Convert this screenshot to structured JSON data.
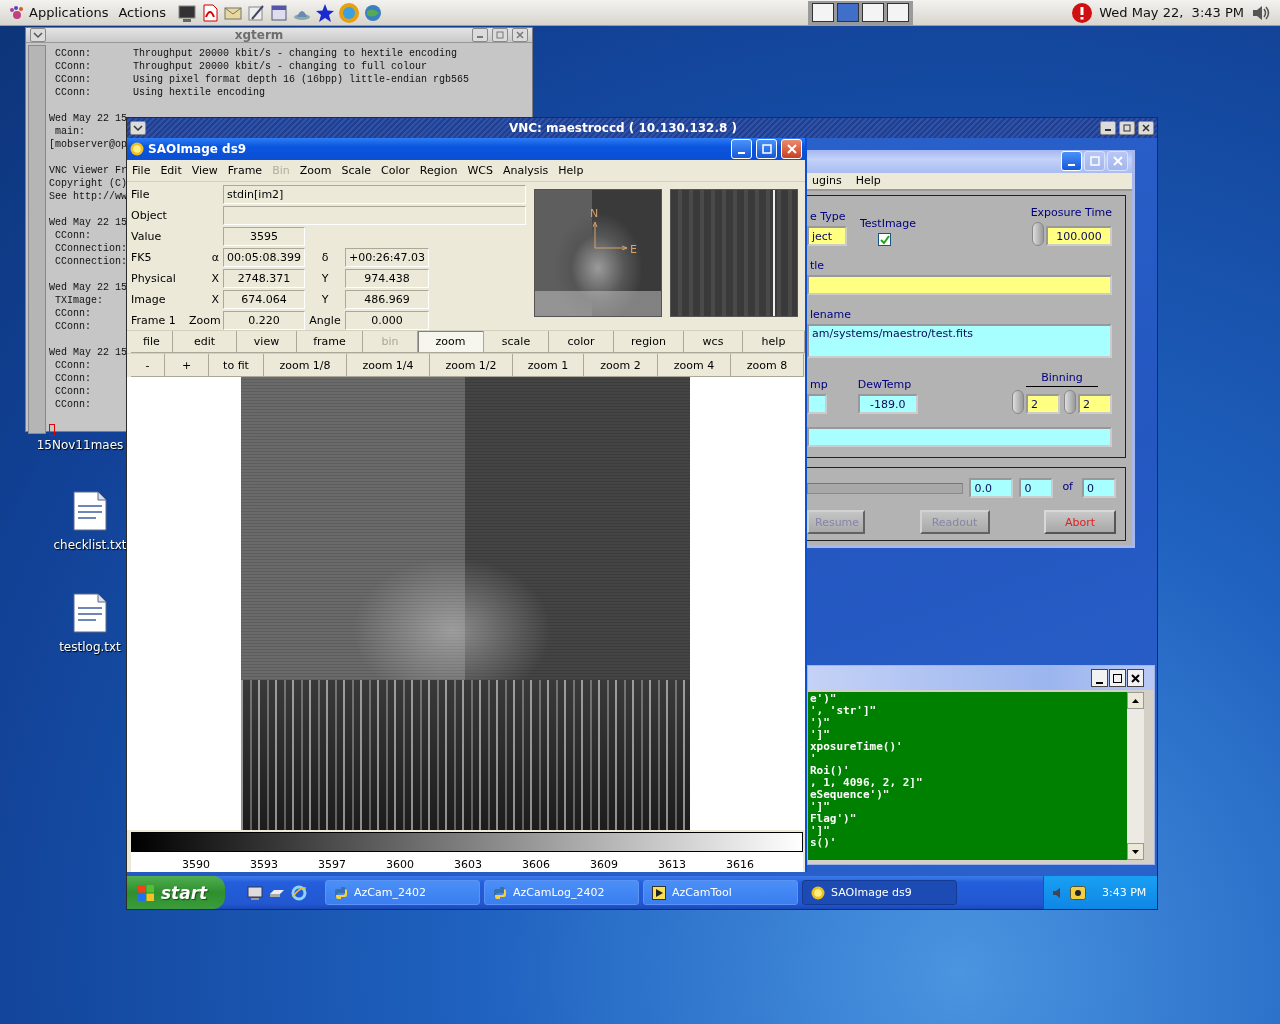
{
  "top_panel": {
    "menus": [
      "Applications",
      "Actions"
    ],
    "workspaces": [
      {
        "selected": false
      },
      {
        "selected": true
      },
      {
        "selected": false
      },
      {
        "selected": false
      }
    ],
    "clock": "Wed May 22,  3:43 PM"
  },
  "desktop_icons": [
    {
      "label": "15Nov11maes",
      "kind": "hidden"
    },
    {
      "label": "checklist.txt",
      "kind": "text"
    },
    {
      "label": "testlog.txt",
      "kind": "text"
    }
  ],
  "xgterm": {
    "title": "xgterm",
    "blocks": [
      [
        " CConn:       Throughput 20000 kbit/s - changing to hextile encoding",
        " CConn:       Throughput 20000 kbit/s - changing to full colour",
        " CConn:       Using pixel format depth 16 (16bpp) little-endian rgb565",
        " CConn:       Using hextile encoding"
      ],
      [
        "Wed May 22 15",
        " main:",
        "[mobserver@op"
      ],
      [
        "VNC Viewer Fr",
        "Copyright (C)",
        "See http://ww"
      ],
      [
        "Wed May 22 15",
        " CConn:",
        " CConnection:",
        " CConnection:"
      ],
      [
        "Wed May 22 15",
        " TXImage:",
        " CConn:",
        " CConn:"
      ],
      [
        "Wed May 22 15",
        " CConn:",
        " CConn:",
        " CConn:",
        " CConn:"
      ]
    ]
  },
  "vnc": {
    "title": "VNC: maestroccd ( 10.130.132.8 )",
    "ds9": {
      "title": "SAOImage ds9",
      "menu": [
        {
          "label": "File",
          "disabled": false
        },
        {
          "label": "Edit",
          "disabled": false
        },
        {
          "label": "View",
          "disabled": false
        },
        {
          "label": "Frame",
          "disabled": false
        },
        {
          "label": "Bin",
          "disabled": true
        },
        {
          "label": "Zoom",
          "disabled": false
        },
        {
          "label": "Scale",
          "disabled": false
        },
        {
          "label": "Color",
          "disabled": false
        },
        {
          "label": "Region",
          "disabled": false
        },
        {
          "label": "WCS",
          "disabled": false
        },
        {
          "label": "Analysis",
          "disabled": false
        },
        {
          "label": "Help",
          "disabled": false
        }
      ],
      "info": {
        "file": {
          "label": "File",
          "value": "stdin[im2]"
        },
        "object": {
          "label": "Object"
        },
        "value": {
          "label": "Value",
          "value": "3595"
        },
        "rows": [
          {
            "label": "FK5",
            "sub1": "α",
            "value1": "00:05:08.399",
            "sub2": "δ",
            "value2": "+00:26:47.03"
          },
          {
            "label": "Physical",
            "sub1": "X",
            "value1": "2748.371",
            "sub2": "Y",
            "value2": "974.438"
          },
          {
            "label": "Image",
            "sub1": "X",
            "value1": "674.064",
            "sub2": "Y",
            "value2": "486.969"
          },
          {
            "label": "Frame 1",
            "sub1": "Zoom",
            "value1": "0.220",
            "sub2": "Angle",
            "value2": "0.000"
          }
        ]
      },
      "panner": {
        "compass": [
          "N",
          "E"
        ]
      },
      "buttons": [
        {
          "label": "file",
          "selected": false,
          "disabled": false
        },
        {
          "label": "edit",
          "selected": false,
          "disabled": false
        },
        {
          "label": "view",
          "selected": false,
          "disabled": false
        },
        {
          "label": "frame",
          "selected": false,
          "disabled": false
        },
        {
          "label": "bin",
          "selected": false,
          "disabled": true
        },
        {
          "label": "zoom",
          "selected": true,
          "disabled": false
        },
        {
          "label": "scale",
          "selected": false,
          "disabled": false
        },
        {
          "label": "color",
          "selected": false,
          "disabled": false
        },
        {
          "label": "region",
          "selected": false,
          "disabled": false
        },
        {
          "label": "wcs",
          "selected": false,
          "disabled": false
        },
        {
          "label": "help",
          "selected": false,
          "disabled": false
        }
      ],
      "zoom_buttons": [
        "-",
        "+",
        "to fit",
        "zoom 1/8",
        "zoom 1/4",
        "zoom 1/2",
        "zoom 1",
        "zoom 2",
        "zoom 4",
        "zoom 8"
      ],
      "colorbar_ticks": [
        "3590",
        "3593",
        "3597",
        "3600",
        "3603",
        "3606",
        "3609",
        "3613",
        "3616"
      ]
    },
    "azcamtool": {
      "menu": [
        "ugins",
        "Help"
      ],
      "image_type": {
        "label": "e Type",
        "value": "ject"
      },
      "test_image": {
        "label": "TestImage",
        "checked": true
      },
      "exposure": {
        "label": "Exposure Time",
        "value": "100.000"
      },
      "title_field": {
        "label": "tle"
      },
      "filename": {
        "label": "lename",
        "value": "am/systems/maestro/test.fits"
      },
      "temp": {
        "label": "mp"
      },
      "dewtemp": {
        "label": "DewTemp",
        "value": "-189.0"
      },
      "binning": {
        "label": "Binning",
        "values": [
          "2",
          "2"
        ]
      },
      "progress": {
        "elapsed": "0.0",
        "current": "0",
        "of": "of",
        "total": "0"
      },
      "buttons": [
        {
          "label": "Resume",
          "disabled": true,
          "kind": "normal"
        },
        {
          "label": "Readout",
          "disabled": true,
          "kind": "normal"
        },
        {
          "label": "Abort",
          "disabled": false,
          "kind": "danger"
        }
      ]
    },
    "console": {
      "lines": [
        "e')\"",
        "', 'str']\"",
        "')\"",
        "']\"",
        "xposureTime()'",
        "'",
        "Roi()'",
        ", 1, 4096, 2, 2]\"",
        "eSequence')\"",
        "']\"",
        "Flag')\"",
        "']\"",
        "s()'"
      ]
    },
    "taskbar": {
      "start": "start",
      "tasks": [
        {
          "label": "AzCam_2402",
          "kind": "python",
          "selected": false
        },
        {
          "label": "AzCamLog_2402",
          "kind": "python",
          "selected": false
        },
        {
          "label": "AzCamTool",
          "kind": "labview",
          "selected": false
        },
        {
          "label": "SAOImage ds9",
          "kind": "sun",
          "selected": true
        }
      ],
      "clock": "3:43 PM"
    }
  }
}
